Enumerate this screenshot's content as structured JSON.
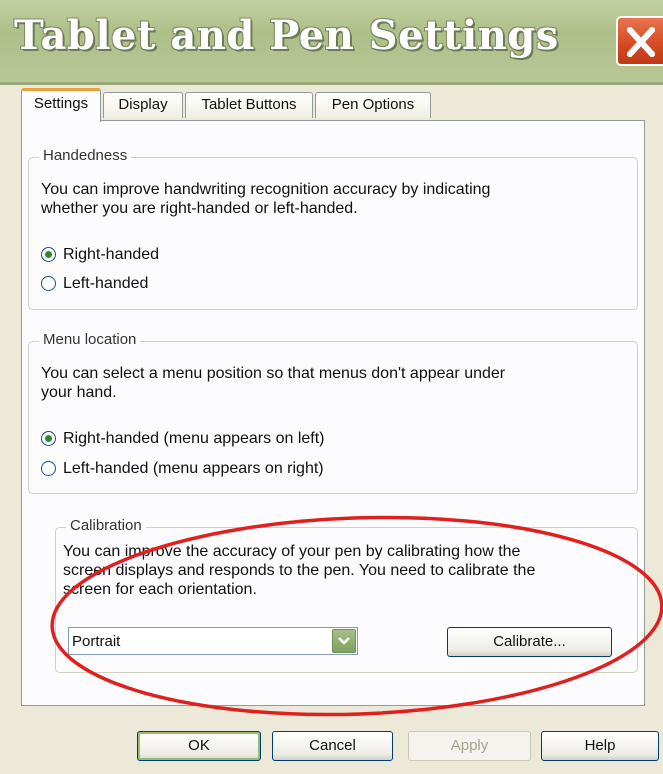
{
  "window": {
    "title": "Tablet and Pen Settings",
    "close_icon": "close-icon"
  },
  "tabs": [
    {
      "label": "Settings",
      "active": true
    },
    {
      "label": "Display",
      "active": false
    },
    {
      "label": "Tablet Buttons",
      "active": false
    },
    {
      "label": "Pen Options",
      "active": false
    }
  ],
  "handedness": {
    "label": "Handedness",
    "description_line1": "You can improve handwriting recognition accuracy by indicating",
    "description_line2": "whether you are right-handed or left-handed.",
    "options": [
      {
        "label": "Right-handed",
        "selected": true
      },
      {
        "label": "Left-handed",
        "selected": false
      }
    ]
  },
  "menu_location": {
    "label": "Menu location",
    "description_line1": "You can select a menu position so that menus don't appear under",
    "description_line2": "your hand.",
    "options": [
      {
        "label": "Right-handed (menu appears on left)",
        "selected": true
      },
      {
        "label": "Left-handed (menu appears on right)",
        "selected": false
      }
    ]
  },
  "calibration": {
    "label": "Calibration",
    "description_line1": "You can improve the accuracy of your pen by calibrating how the",
    "description_line2": "screen displays and responds to the pen. You need to calibrate the",
    "description_line3": "screen for each orientation.",
    "orientation_value": "Portrait",
    "calibrate_label": "Calibrate..."
  },
  "buttons": {
    "ok": "OK",
    "cancel": "Cancel",
    "apply": "Apply",
    "help": "Help"
  },
  "colors": {
    "titlebar": "#b9c796",
    "tab_highlight": "#e8a33d",
    "radio_dot": "#2f8a2a",
    "annotation": "#e0201e",
    "close_button": "#d44a22"
  }
}
